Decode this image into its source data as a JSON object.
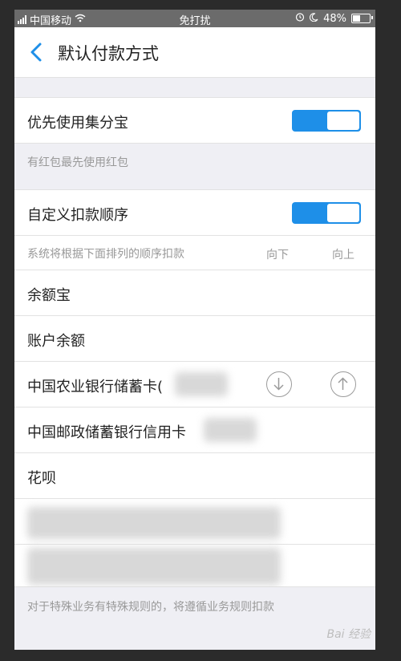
{
  "status": {
    "carrier": "中国移动",
    "center": "免打扰",
    "battery": "48%"
  },
  "nav": {
    "title": "默认付款方式"
  },
  "section1": {
    "label": "优先使用集分宝",
    "toggle_on": true,
    "hint": "有红包最先使用红包"
  },
  "section2": {
    "label": "自定义扣款顺序",
    "toggle_on": true,
    "hint": "系统将根据下面排列的顺序扣款",
    "col_down": "向下",
    "col_up": "向上"
  },
  "methods": [
    {
      "label": "余额宝"
    },
    {
      "label": "账户余额"
    },
    {
      "label": "中国农业银行储蓄卡("
    },
    {
      "label": "中国邮政储蓄银行信用卡"
    },
    {
      "label": "花呗"
    }
  ],
  "footer": {
    "note": "对于特殊业务有特殊规则的，将遵循业务规则扣款"
  },
  "watermark": "Bai 经验",
  "colors": {
    "accent": "#1e8fe8",
    "background": "#efeff4"
  }
}
